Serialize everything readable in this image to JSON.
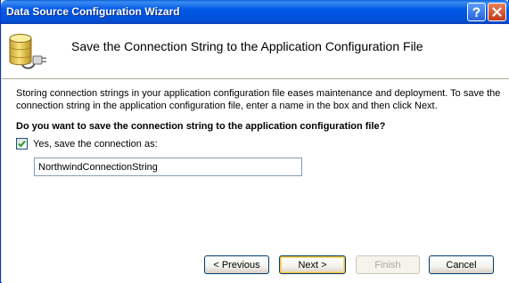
{
  "window": {
    "title": "Data Source Configuration Wizard",
    "help_icon": "question-mark-icon",
    "close_icon": "close-x-icon"
  },
  "header": {
    "icon": "database-plug-icon",
    "title": "Save the Connection String to the Application Configuration File"
  },
  "content": {
    "description": "Storing connection strings in your application configuration file eases maintenance and deployment. To save the connection string in the application configuration file, enter a name in the box and then click Next.",
    "question": "Do you want to save the connection string to the application configuration file?",
    "save_checkbox": {
      "label": "Yes, save the connection as:",
      "checked": true
    },
    "connection_name": {
      "value": "NorthwindConnectionString"
    }
  },
  "buttons": {
    "previous": "< Previous",
    "next": "Next >",
    "finish": "Finish",
    "cancel": "Cancel"
  },
  "colors": {
    "titlebar": "#0058e6",
    "dialog_face": "#ece9d8",
    "close_button": "#c1391a",
    "default_button_focus": "#f0c040"
  }
}
